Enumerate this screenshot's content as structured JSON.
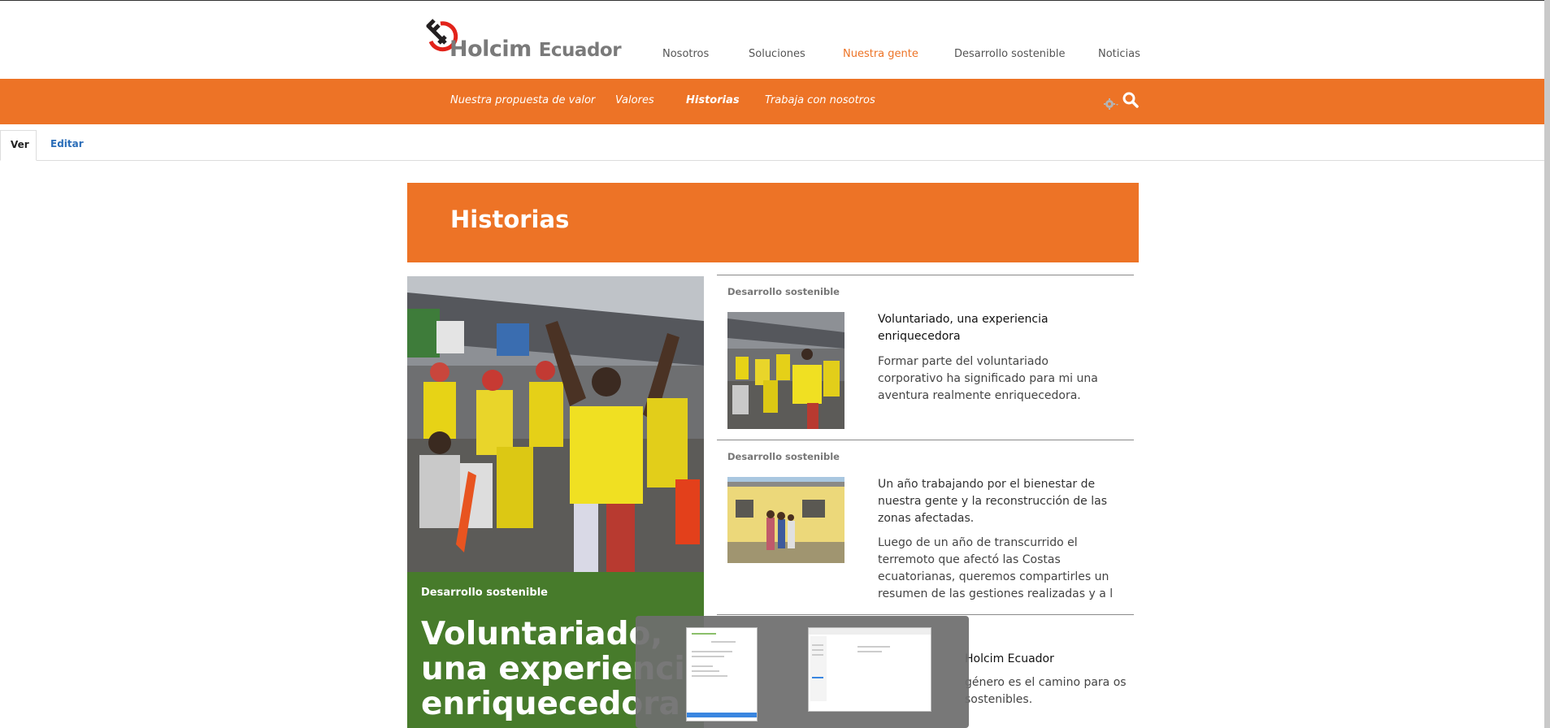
{
  "brand": {
    "name": "Holcim",
    "sub": "Ecuador",
    "logo_color_red": "#e2231a",
    "logo_color_black": "#231f20"
  },
  "main_nav": [
    {
      "label": "Nosotros",
      "active": false
    },
    {
      "label": "Soluciones",
      "active": false
    },
    {
      "label": "Nuestra gente",
      "active": true
    },
    {
      "label": "Desarrollo sostenible",
      "active": false
    },
    {
      "label": "Noticias",
      "active": false
    }
  ],
  "sub_nav": [
    {
      "label": "Nuestra propuesta de valor",
      "active": false
    },
    {
      "label": "Valores",
      "active": false
    },
    {
      "label": "Historias",
      "active": true
    },
    {
      "label": "Trabaja con nosotros",
      "active": false
    }
  ],
  "icons": {
    "gear": "gear-icon",
    "search": "search-icon"
  },
  "tabs": {
    "view": "Ver",
    "edit": "Editar"
  },
  "page_title": "Historias",
  "featured": {
    "category": "Desarrollo sostenible",
    "title": "Voluntariado, una experiencia enriquecedora"
  },
  "stories": [
    {
      "category": "Desarrollo sostenible",
      "title": "Voluntariado, una experiencia enriquecedora",
      "description": "Formar parte del voluntariado corporativo ha significado para mi una aventura realmente enriquecedora."
    },
    {
      "category": "Desarrollo sostenible",
      "title": "Un año trabajando por el bienestar de nuestra gente y la reconstrucción de las zonas afectadas.",
      "description": "Luego de un año de transcurrido el terremoto que afectó las Costas ecuatorianas, queremos compartirles un resumen de las gestiones realizadas y a l"
    },
    {
      "category": "",
      "title": "Holcim Ecuador",
      "description": "género es el camino para os sostenibles."
    }
  ],
  "colors": {
    "accent": "#ed7326",
    "featured_bg": "#477b2b",
    "link": "#2a6db8"
  }
}
